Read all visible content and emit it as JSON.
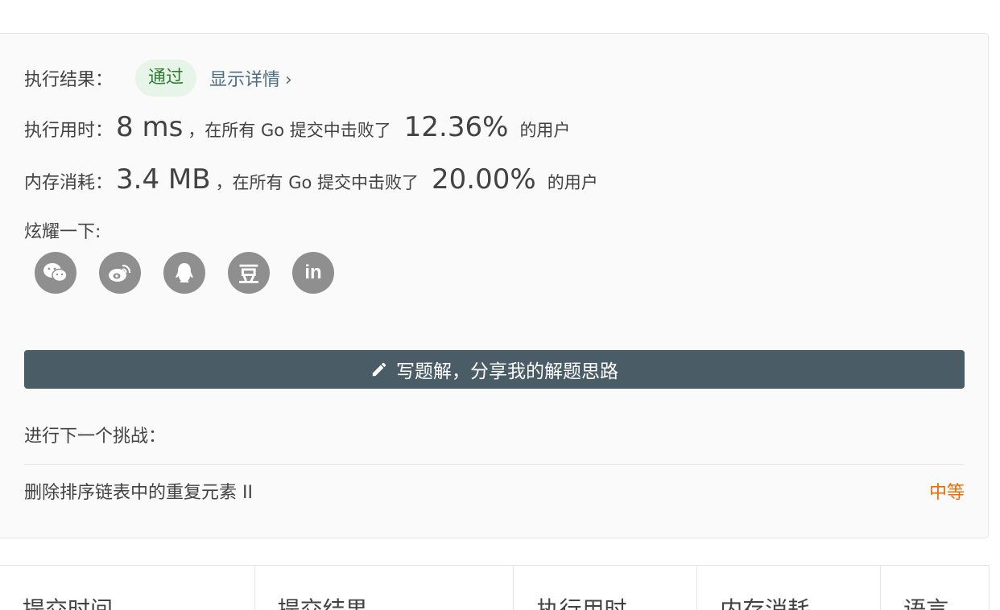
{
  "result": {
    "label": "执行结果：",
    "status": "通过",
    "details_link": "显示详情",
    "details_chevron": "›"
  },
  "runtime": {
    "label": "执行用时：",
    "value": "8 ms",
    "text_before": "，在所有 Go 提交中击败了",
    "percent": "12.36%",
    "text_after": "的用户"
  },
  "memory": {
    "label": "内存消耗：",
    "value": "3.4 MB",
    "text_before": "，在所有 Go 提交中击败了",
    "percent": "20.00%",
    "text_after": "的用户"
  },
  "share": {
    "label": "炫耀一下:",
    "icons": [
      "wechat-icon",
      "weibo-icon",
      "qq-icon",
      "douban-icon",
      "linkedin-icon"
    ],
    "douban_glyph": "豆",
    "linkedin_glyph": "in"
  },
  "write_solution": {
    "label": "写题解，分享我的解题思路",
    "icon": "pencil-icon"
  },
  "next_challenge": {
    "label": "进行下一个挑战：",
    "problem": "删除排序链表中的重复元素 II",
    "difficulty": "中等"
  },
  "submissions_table": {
    "columns": [
      "提交时间",
      "提交结果",
      "执行用时",
      "内存消耗",
      "语言"
    ]
  },
  "colors": {
    "accepted_bg": "#e7f4e8",
    "accepted_text": "#2e7d32",
    "link": "#4e6e82",
    "button_bg": "#4a5c66",
    "difficulty_medium": "#ef6c00",
    "share_icon_bg": "#8f8f8f"
  }
}
